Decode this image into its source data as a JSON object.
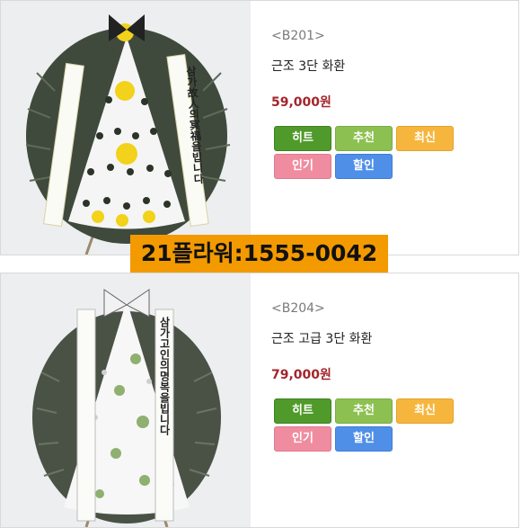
{
  "products": [
    {
      "code": "<B201>",
      "name": "근조 3단 화환",
      "price": "59,000원",
      "image_alt": "funeral wreath 3-tier yellow accent"
    },
    {
      "code": "<B204>",
      "name": "근조 고급 3단 화환",
      "price": "79,000원",
      "image_alt": "premium funeral wreath 3-tier"
    }
  ],
  "tags": {
    "hit": "히트",
    "recommend": "추천",
    "newest": "최신",
    "popular": "인기",
    "sale": "할인"
  },
  "banner_text": "21플라워:1555-0042",
  "ribbon_texts": {
    "p1_right": "삼가故人의冥福을빕니다",
    "p2_right": "삼가고인의명복을빕니다"
  },
  "colors": {
    "price": "#a3252c",
    "hit": "#4f9a2a",
    "recommend": "#8cc152",
    "newest": "#f6b63e",
    "popular": "#f08ca0",
    "sale": "#4f8fe8",
    "banner": "#f39a00"
  }
}
